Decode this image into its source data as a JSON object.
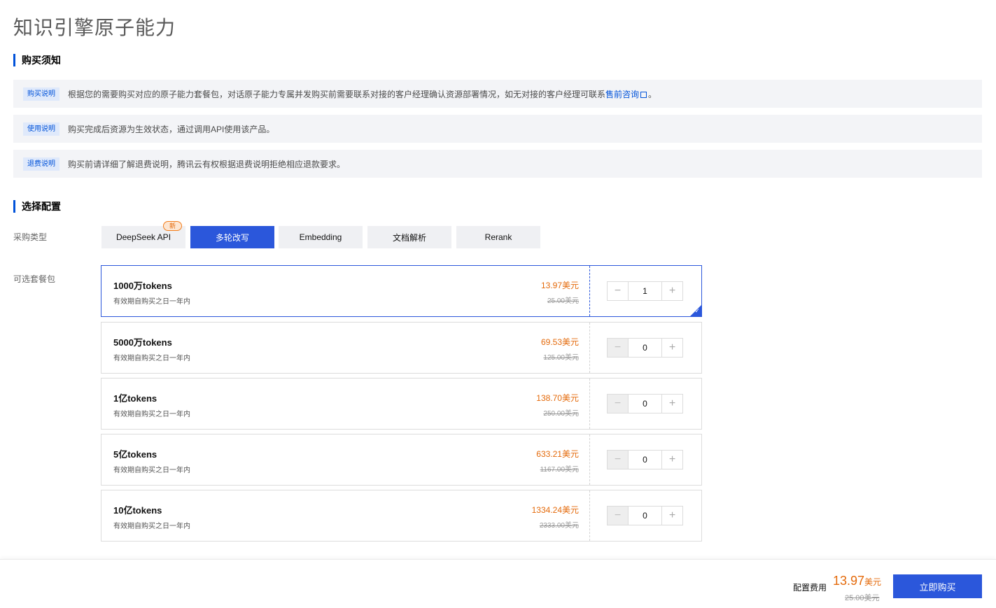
{
  "page": {
    "title": "知识引擎原子能力"
  },
  "purchase_notice": {
    "heading": "购买须知",
    "items": [
      {
        "tag": "购买说明",
        "text": "根据您的需要购买对应的原子能力套餐包，对话原子能力专属并发购买前需要联系对接的客户经理确认资源部署情况，如无对接的客户经理可联系",
        "link": "售前咨询",
        "suffix": "。"
      },
      {
        "tag": "使用说明",
        "text": "购买完成后资源为生效状态，通过调用API使用该产品。"
      },
      {
        "tag": "退费说明",
        "text": "购买前请详细了解退费说明，腾讯云有权根据退费说明拒绝相应退款要求。"
      }
    ]
  },
  "config": {
    "heading": "选择配置",
    "type_label": "采购类型",
    "new_badge": "新",
    "types": [
      "DeepSeek API",
      "多轮改写",
      "Embedding",
      "文档解析",
      "Rerank"
    ],
    "active_type": "多轮改写",
    "package_label": "可选套餐包",
    "packages": [
      {
        "name": "1000万tokens",
        "validity": "有效期自购买之日一年内",
        "price": "13.97美元",
        "original_price": "25.00美元",
        "quantity": "1",
        "selected": true
      },
      {
        "name": "5000万tokens",
        "validity": "有效期自购买之日一年内",
        "price": "69.53美元",
        "original_price": "125.00美元",
        "quantity": "0",
        "selected": false
      },
      {
        "name": "1亿tokens",
        "validity": "有效期自购买之日一年内",
        "price": "138.70美元",
        "original_price": "250.00美元",
        "quantity": "0",
        "selected": false
      },
      {
        "name": "5亿tokens",
        "validity": "有效期自购买之日一年内",
        "price": "633.21美元",
        "original_price": "1167.00美元",
        "quantity": "0",
        "selected": false
      },
      {
        "name": "10亿tokens",
        "validity": "有效期自购买之日一年内",
        "price": "1334.24美元",
        "original_price": "2333.00美元",
        "quantity": "0",
        "selected": false
      }
    ]
  },
  "footer": {
    "fee_label": "配置费用",
    "fee_amount": "13.97",
    "fee_unit": "美元",
    "fee_original": "25.00美元",
    "buy_label": "立即购买"
  },
  "icons": {
    "external_link": "external-link-icon",
    "check": "check-icon",
    "minus": "minus-icon",
    "plus": "plus-icon"
  },
  "colors": {
    "accent": "#2b57db",
    "price": "#e46a0b",
    "notice_bg": "#f3f4f7"
  }
}
